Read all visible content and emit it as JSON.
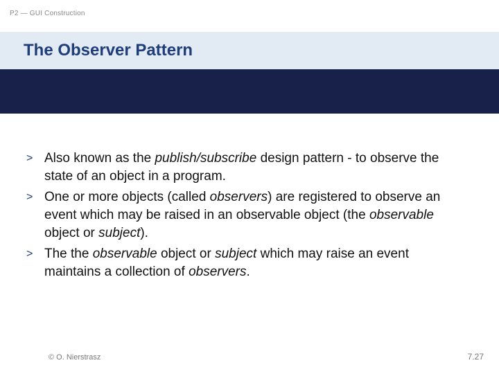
{
  "breadcrumb": "P2 — GUI Construction",
  "title": "The Observer Pattern",
  "bullets": {
    "marker": ">",
    "b1": {
      "t1": "Also known as the ",
      "i1": "publish/subscribe",
      "t2": " design pattern - to observe the state of an object in a program."
    },
    "b2": {
      "t1": "One or more objects (called ",
      "i1": "observers",
      "t2": ") are registered to observe an event which may be raised in an observable object (the ",
      "i2": "observable",
      "t3": " object or ",
      "i3": "subject",
      "t4": ")."
    },
    "b3": {
      "t1": "The the ",
      "i1": "observable",
      "t2": " object or ",
      "i2": "subject",
      "t3": " which may raise an event maintains a collection of ",
      "i3": "observers",
      "t4": "."
    }
  },
  "footer": {
    "copyright": "© O. Nierstrasz",
    "page": "7.27"
  }
}
